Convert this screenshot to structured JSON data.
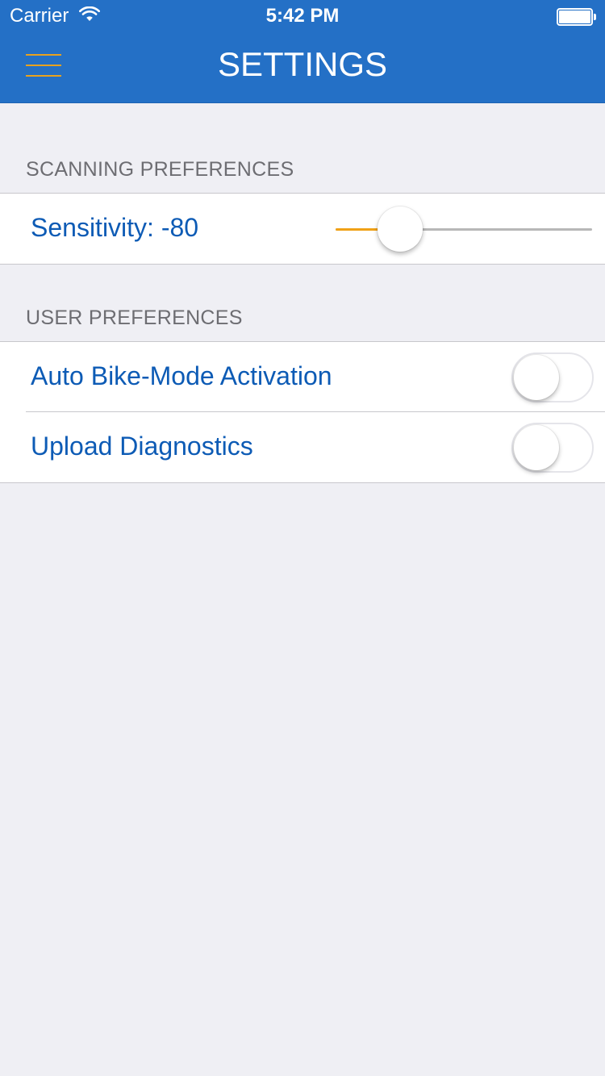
{
  "status_bar": {
    "carrier": "Carrier",
    "time": "5:42 PM",
    "icons": [
      "wifi-icon",
      "battery-icon"
    ]
  },
  "nav": {
    "title": "SETTINGS",
    "menu_icon": "hamburger-menu-icon"
  },
  "colors": {
    "nav_background": "#2470c6",
    "accent": "#f0a116",
    "label_text": "#0d5bb5",
    "section_header_text": "#6d6d72",
    "background": "#efeff4"
  },
  "sections": [
    {
      "header": "SCANNING PREFERENCES",
      "rows": [
        {
          "label": "Sensitivity: -80",
          "control": "slider",
          "slider_fraction": 0.25
        }
      ]
    },
    {
      "header": "USER PREFERENCES",
      "rows": [
        {
          "label": "Auto Bike-Mode Activation",
          "control": "toggle",
          "on": false
        },
        {
          "label": "Upload Diagnostics",
          "control": "toggle",
          "on": false
        }
      ]
    }
  ]
}
